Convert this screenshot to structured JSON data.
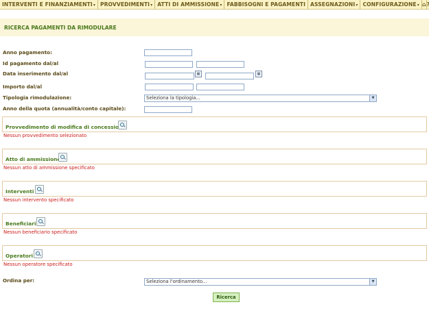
{
  "menu": {
    "items": [
      "INTERVENTI E FINANZIAMENTI",
      "PROVVEDIMENTI",
      "ATTI DI AMMISSIONE",
      "FABBISOGNI E PAGAMENTI",
      "ASSEGNAZIONI",
      "CONFIGURAZIONE"
    ],
    "caret": "▾",
    "home_icon": "⌂",
    "help_icon": "?"
  },
  "page": {
    "title": "RICERCA PAGAMENTI DA RIMODULARE"
  },
  "form": {
    "anno_pagamento": "Anno pagamento:",
    "id_pagamento": "Id pagamento dal/al",
    "data_inserimento": "Data inserimento dal/al",
    "importo": "Importo dal/al",
    "tipologia": "Tipologia rimodulazione:",
    "tipologia_value": "Seleziona la tipologia...",
    "anno_quota": "Anno della quota (annualità/conto capitale):"
  },
  "sections": [
    {
      "label": "Provvedimento di modifica di concessione",
      "message": "Nessun provvedimento selezionato"
    },
    {
      "label": "Atto di ammissione",
      "message": "Nessun atto di ammissione specificato"
    },
    {
      "label": "Interventi",
      "message": "Nessun intervento specificato"
    },
    {
      "label": "Beneficiari",
      "message": "Nessun beneficiario specificato"
    },
    {
      "label": "Operatori",
      "message": "Nessun operatore specificato"
    }
  ],
  "order": {
    "label": "Ordina per:",
    "value": "Seleziona l'ordinamento..."
  },
  "search_button": "Ricerca"
}
